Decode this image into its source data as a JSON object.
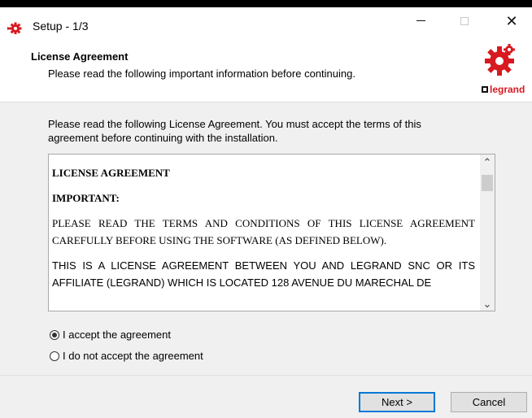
{
  "window": {
    "title": "Setup - 1/3",
    "app_icon": "setup-gear-icon",
    "controls": {
      "minimize": "minimize-icon",
      "maximize": "maximize-icon",
      "close": "close-icon",
      "close_glyph": "✕"
    }
  },
  "header": {
    "title": "License Agreement",
    "subtitle": "Please read the following important information before continuing.",
    "logo_text": "legrand",
    "brand_color": "#d71920"
  },
  "content": {
    "intro_line1": "Please read the following License Agreement. You must accept the terms of this",
    "intro_line2": "agreement before continuing with the installation.",
    "license": {
      "heading": "LICENSE AGREEMENT",
      "important": "IMPORTANT:",
      "para1": "PLEASE READ THE TERMS AND CONDITIONS OF THIS LICENSE AGREEMENT CAREFULLY BEFORE USING THE SOFTWARE (AS DEFINED BELOW).",
      "para2": "THIS IS A LICENSE AGREEMENT BETWEEN YOU AND LEGRAND SNC OR ITS AFFILIATE (LEGRAND) WHICH IS LOCATED 128 AVENUE DU MARECHAL DE"
    },
    "scroll_up_glyph": "⌃",
    "scroll_down_glyph": "⌄",
    "options": [
      {
        "label": "I accept the agreement",
        "checked": true
      },
      {
        "label": "I do not accept the agreement",
        "checked": false
      }
    ]
  },
  "footer": {
    "next_label": "Next >",
    "cancel_label": "Cancel",
    "focus_color": "#0078d7"
  }
}
